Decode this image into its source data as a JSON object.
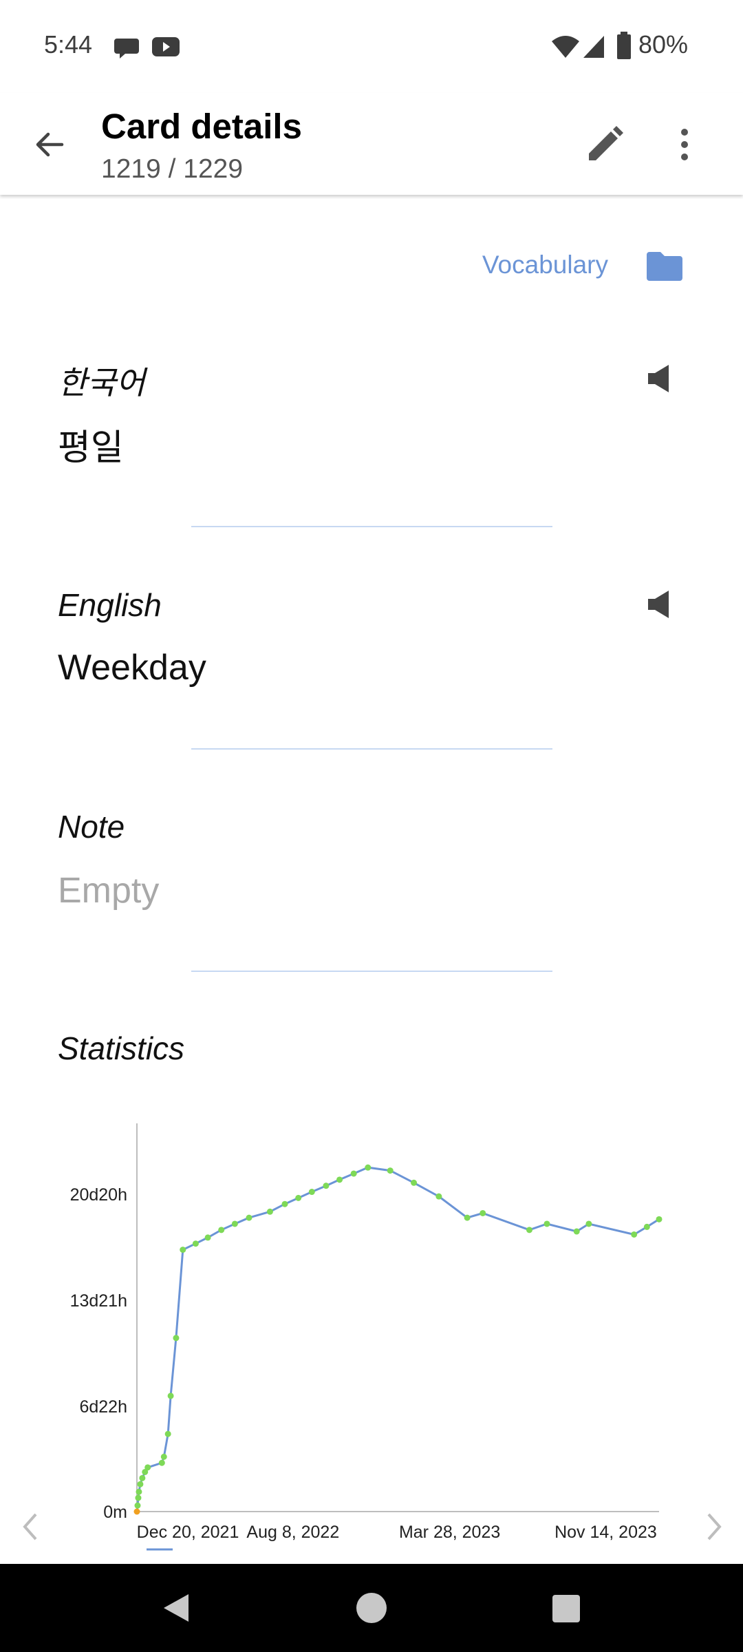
{
  "status_bar": {
    "time": "5:44",
    "battery": "80%",
    "icons": [
      "chat-bubble-icon",
      "youtube-icon",
      "wifi-icon",
      "cellular-signal-icon",
      "battery-icon"
    ]
  },
  "app_bar": {
    "title": "Card details",
    "subtitle": "1219 / 1229",
    "icons": [
      "back-arrow-icon",
      "edit-pencil-icon",
      "more-vert-icon"
    ]
  },
  "deck": {
    "name": "Vocabulary",
    "icon": "folder-icon"
  },
  "fields": [
    {
      "label": "한국어",
      "value": "평일",
      "has_audio": true
    },
    {
      "label": "English",
      "value": "Weekday",
      "has_audio": true
    },
    {
      "label": "Note",
      "value": "Empty",
      "has_audio": false
    }
  ],
  "statistics": {
    "title": "Statistics",
    "nav_icons": [
      "chevron-left-icon",
      "chevron-right-icon"
    ]
  },
  "chart_data": {
    "type": "line",
    "title": "",
    "xlabel": "",
    "ylabel": "",
    "y_ticks": [
      "0m",
      "6d22h",
      "13d21h",
      "20d20h"
    ],
    "x_ticks": [
      "Dec 20, 2021",
      "Aug 8, 2022",
      "Mar 28, 2023",
      "Nov 14, 2023"
    ],
    "y_unit_note": "interval",
    "ylim_days": [
      0,
      25.5
    ],
    "xlim": [
      "2021-12-20",
      "2024-02-01"
    ],
    "series": [
      {
        "points": [
          [
            "2021-12-20",
            0.0
          ],
          [
            "2021-12-21",
            0.4
          ],
          [
            "2021-12-22",
            0.9
          ],
          [
            "2021-12-23",
            1.3
          ],
          [
            "2021-12-25",
            1.8
          ],
          [
            "2021-12-28",
            2.2
          ],
          [
            "2022-01-01",
            2.6
          ],
          [
            "2022-01-05",
            2.9
          ],
          [
            "2022-01-26",
            3.2
          ],
          [
            "2022-01-29",
            3.6
          ],
          [
            "2022-02-04",
            5.1
          ],
          [
            "2022-02-08",
            7.6
          ],
          [
            "2022-02-16",
            11.4
          ],
          [
            "2022-02-26",
            17.2
          ],
          [
            "2022-03-17",
            17.6
          ],
          [
            "2022-04-04",
            18.0
          ],
          [
            "2022-04-24",
            18.5
          ],
          [
            "2022-05-14",
            18.9
          ],
          [
            "2022-06-04",
            19.3
          ],
          [
            "2022-07-05",
            19.7
          ],
          [
            "2022-07-27",
            20.2
          ],
          [
            "2022-08-16",
            20.6
          ],
          [
            "2022-09-05",
            21.0
          ],
          [
            "2022-09-26",
            21.4
          ],
          [
            "2022-10-16",
            21.8
          ],
          [
            "2022-11-06",
            22.2
          ],
          [
            "2022-11-27",
            22.6
          ],
          [
            "2022-12-30",
            22.4
          ],
          [
            "2023-02-03",
            21.6
          ],
          [
            "2023-03-12",
            20.7
          ],
          [
            "2023-04-23",
            19.3
          ],
          [
            "2023-05-16",
            19.6
          ],
          [
            "2023-07-24",
            18.5
          ],
          [
            "2023-08-19",
            18.9
          ],
          [
            "2023-10-02",
            18.4
          ],
          [
            "2023-10-20",
            18.9
          ],
          [
            "2023-12-26",
            18.2
          ],
          [
            "2024-01-14",
            18.7
          ],
          [
            "2024-02-01",
            19.2
          ]
        ]
      }
    ],
    "colors": {
      "line": "#6b94d6",
      "point": "#7ed957",
      "first_point": "#f0a020",
      "axis": "#bdbdbd"
    }
  },
  "nav_bar": {
    "icons": [
      "nav-back-icon",
      "nav-home-icon",
      "nav-recents-icon"
    ]
  }
}
